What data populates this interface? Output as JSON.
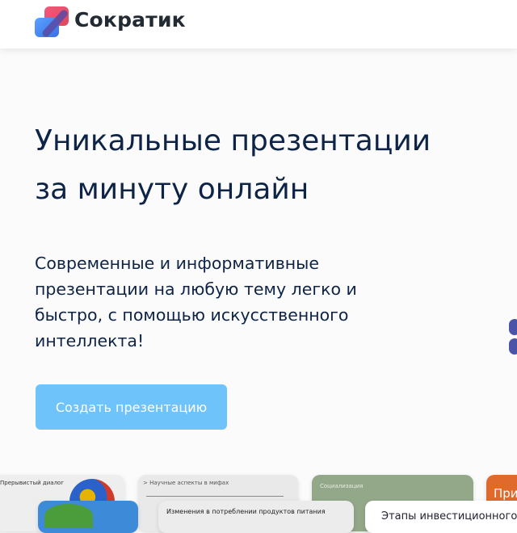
{
  "header": {
    "brand": "Сократик",
    "colors": {
      "logo_top": "#e8546a",
      "logo_bottom": "#4a80f0",
      "logo_mid": "#5b4aa6"
    }
  },
  "hero": {
    "title_line1": "Уникальные презентации",
    "title_line2": "за минуту онлайн",
    "subtitle_lines": [
      "Современные и информативные",
      "презентации на любую тему легко и",
      "быстро, с помощью искусственного",
      "интеллекта!"
    ],
    "cta_label": "Создать презентацию",
    "cta_color": "#6ec3fb"
  },
  "gallery": {
    "cards": [
      {
        "caption": "Прерывистый диалог"
      },
      {
        "caption": ""
      },
      {
        "caption": "> Научные аспекты в мифах"
      },
      {
        "caption": "Изменения в потреблении продуктов питания"
      },
      {
        "caption": "Социализация"
      },
      {
        "caption": "Этапы инвестиционного"
      },
      {
        "caption": "При"
      }
    ]
  }
}
